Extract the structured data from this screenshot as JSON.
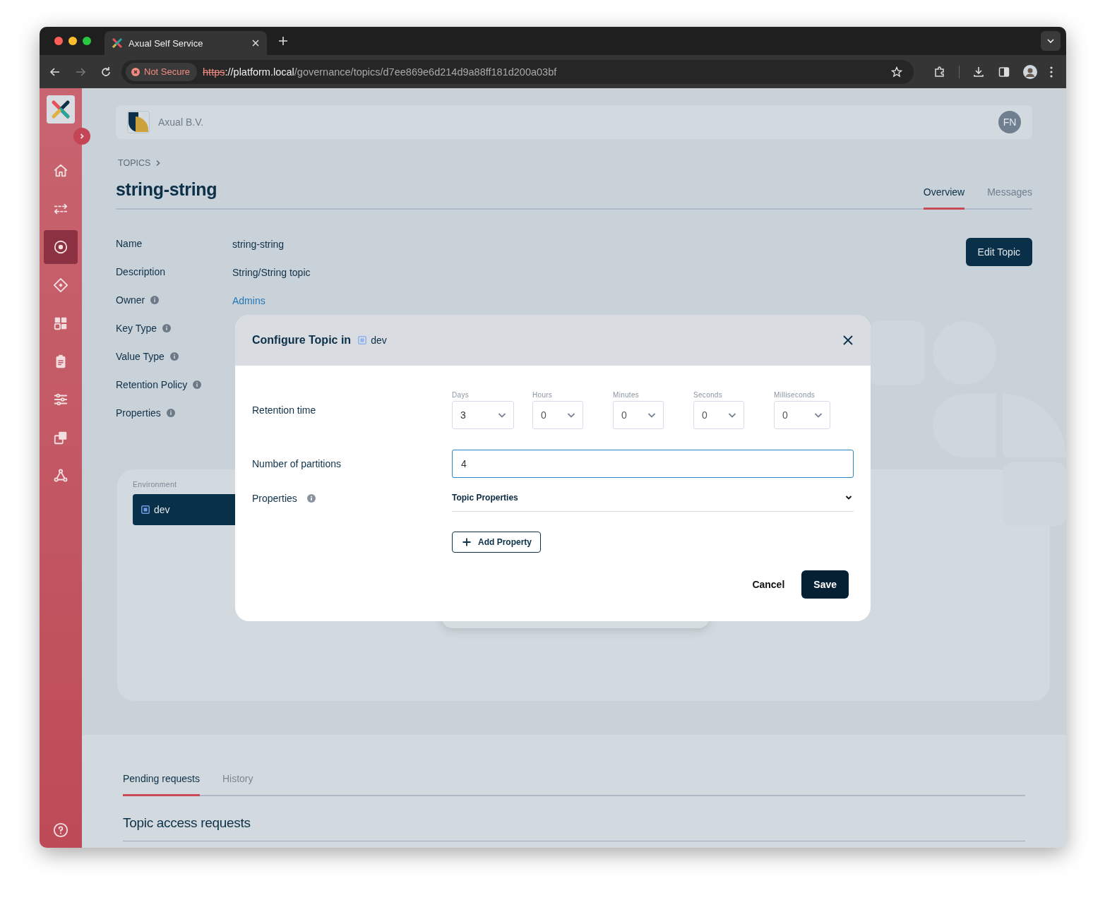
{
  "browser": {
    "tab_title": "Axual Self Service",
    "security": "Not Secure",
    "url": {
      "scheme": "https",
      "host": "://platform.local",
      "path": "/governance/topics/d7ee869e6d214d9a88ff181d200a03bf"
    }
  },
  "sidebar": {
    "items": [
      {
        "kind": "home",
        "selected": false
      },
      {
        "kind": "streams",
        "selected": false
      },
      {
        "kind": "topics",
        "selected": true
      },
      {
        "kind": "diamond",
        "selected": false
      },
      {
        "kind": "grid",
        "selected": false
      },
      {
        "kind": "clipboard",
        "selected": false
      },
      {
        "kind": "sliders",
        "selected": false
      },
      {
        "kind": "copy",
        "selected": false
      },
      {
        "kind": "nodes",
        "selected": false
      }
    ]
  },
  "header": {
    "org": "Axual B.V.",
    "avatar": "FN"
  },
  "breadcrumb": "TOPICS",
  "title": "string-string",
  "tabs": [
    {
      "label": "Overview",
      "selected": true
    },
    {
      "label": "Messages",
      "selected": false
    }
  ],
  "details": [
    {
      "label": "Name",
      "info": false,
      "value": "string-string",
      "link": false
    },
    {
      "label": "Description",
      "info": false,
      "value": "String/String topic",
      "link": false
    },
    {
      "label": "Owner",
      "info": true,
      "value": "Admins",
      "link": true
    },
    {
      "label": "Key Type",
      "info": true
    },
    {
      "label": "Value Type",
      "info": true
    },
    {
      "label": "Retention Policy",
      "info": true
    },
    {
      "label": "Properties",
      "info": true
    }
  ],
  "edit_button": "Edit Topic",
  "environment": {
    "label": "Environment",
    "items": [
      {
        "name": "dev",
        "selected": true
      }
    ]
  },
  "modal": {
    "title": "Configure Topic in",
    "environment": "dev",
    "retention_label": "Retention time",
    "retention": [
      {
        "unit": "Days",
        "value": "3"
      },
      {
        "unit": "Hours",
        "value": "0"
      },
      {
        "unit": "Minutes",
        "value": "0"
      },
      {
        "unit": "Seconds",
        "value": "0"
      },
      {
        "unit": "Milliseconds",
        "value": "0"
      }
    ],
    "partitions_label": "Number of partitions",
    "partitions": "4",
    "properties_label": "Properties",
    "properties_section": "Topic Properties",
    "add_property": "Add Property",
    "cancel": "Cancel",
    "save": "Save"
  },
  "requests": {
    "tabs": [
      {
        "label": "Pending requests",
        "selected": true
      },
      {
        "label": "History",
        "selected": false
      }
    ],
    "heading": "Topic access requests"
  }
}
